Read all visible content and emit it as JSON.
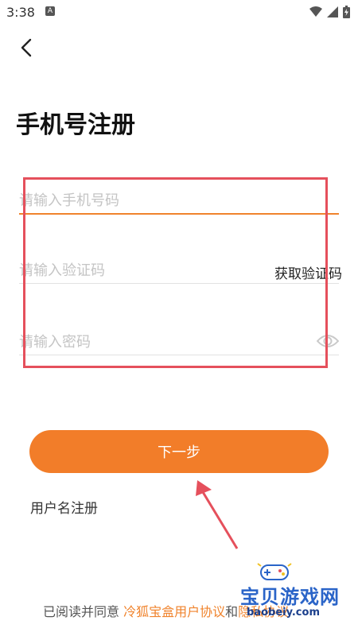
{
  "status_bar": {
    "time": "3:38",
    "notification_badge": "A"
  },
  "header": {
    "back_icon": "chevron-left-icon"
  },
  "page": {
    "title": "手机号注册"
  },
  "form": {
    "phone_placeholder": "请输入手机号码",
    "code_placeholder": "请输入验证码",
    "get_code_label": "获取验证码",
    "password_placeholder": "请输入密码",
    "password_toggle_icon": "eye-icon"
  },
  "actions": {
    "next_label": "下一步",
    "username_register_label": "用户名注册"
  },
  "agreement": {
    "prefix": "已阅读并同意",
    "user_agreement": "冷狐宝盒用户协议",
    "connector": "和",
    "privacy": "隐私协议"
  },
  "watermark": {
    "title": "宝贝游戏网",
    "url": "baobeiy.com"
  },
  "colors": {
    "accent": "#f27d29",
    "annotation_red": "#e5505c",
    "watermark_blue": "#2a64c8"
  }
}
